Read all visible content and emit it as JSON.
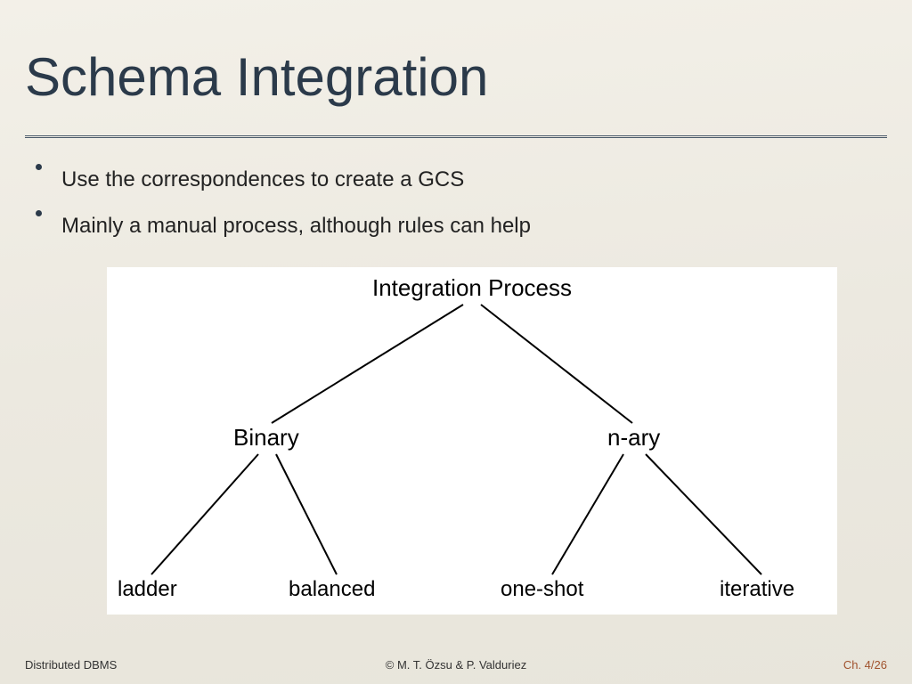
{
  "title": "Schema Integration",
  "bullets": [
    "Use the correspondences to create a GCS",
    "Mainly a manual process, although rules can help"
  ],
  "diagram": {
    "root": "Integration Process",
    "mid_left": "Binary",
    "mid_right": "n-ary",
    "leaves": [
      "ladder",
      "balanced",
      "one-shot",
      "iterative"
    ]
  },
  "footer": {
    "left": "Distributed DBMS",
    "center": "© M. T. Özsu & P. Valduriez",
    "right": "Ch. 4/26"
  },
  "chart_data": {
    "type": "tree",
    "root": "Integration Process",
    "children": [
      {
        "label": "Binary",
        "children": [
          "ladder",
          "balanced"
        ]
      },
      {
        "label": "n-ary",
        "children": [
          "one-shot",
          "iterative"
        ]
      }
    ]
  }
}
